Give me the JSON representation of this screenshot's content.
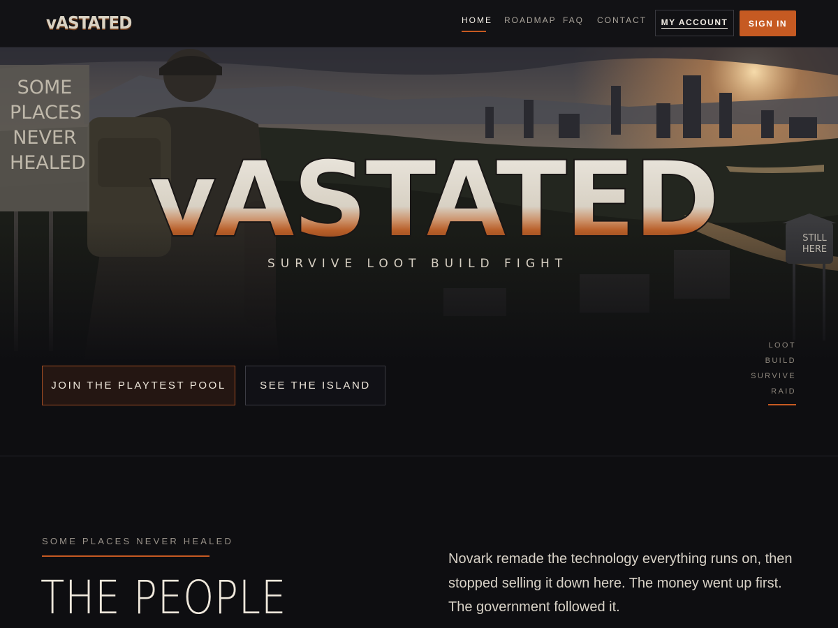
{
  "nav": {
    "logo": "vASTATED",
    "links": [
      {
        "label": "HOME",
        "active": true
      },
      {
        "label": "ROADMAP",
        "active": false
      },
      {
        "label": "FAQ",
        "active": false
      },
      {
        "label": "CONTACT",
        "active": false
      }
    ],
    "account_label": "MY ACCOUNT",
    "signin_label": "SIGN IN"
  },
  "hero": {
    "title": "vASTATED",
    "tagline": "SURVIVE   LOOT   BUILD   FIGHT",
    "sign_text": "SOME PLACES NEVER HEALED",
    "tower_text": "STILL HERE"
  },
  "cta": {
    "primary": "JOIN THE PLAYTEST POOL",
    "secondary": "SEE THE ISLAND"
  },
  "side_list": [
    "LOOT",
    "BUILD",
    "SURVIVE",
    "RAID"
  ],
  "section": {
    "kicker": "SOME PLACES NEVER HEALED",
    "heading": "THE PEOPLE",
    "body": "Novark remade the technology everything runs on, then stopped selling it down here. The money went up first. The government followed it."
  },
  "colors": {
    "accent": "#c65a22",
    "background": "#0e0e11",
    "text": "#e8e2d6"
  }
}
